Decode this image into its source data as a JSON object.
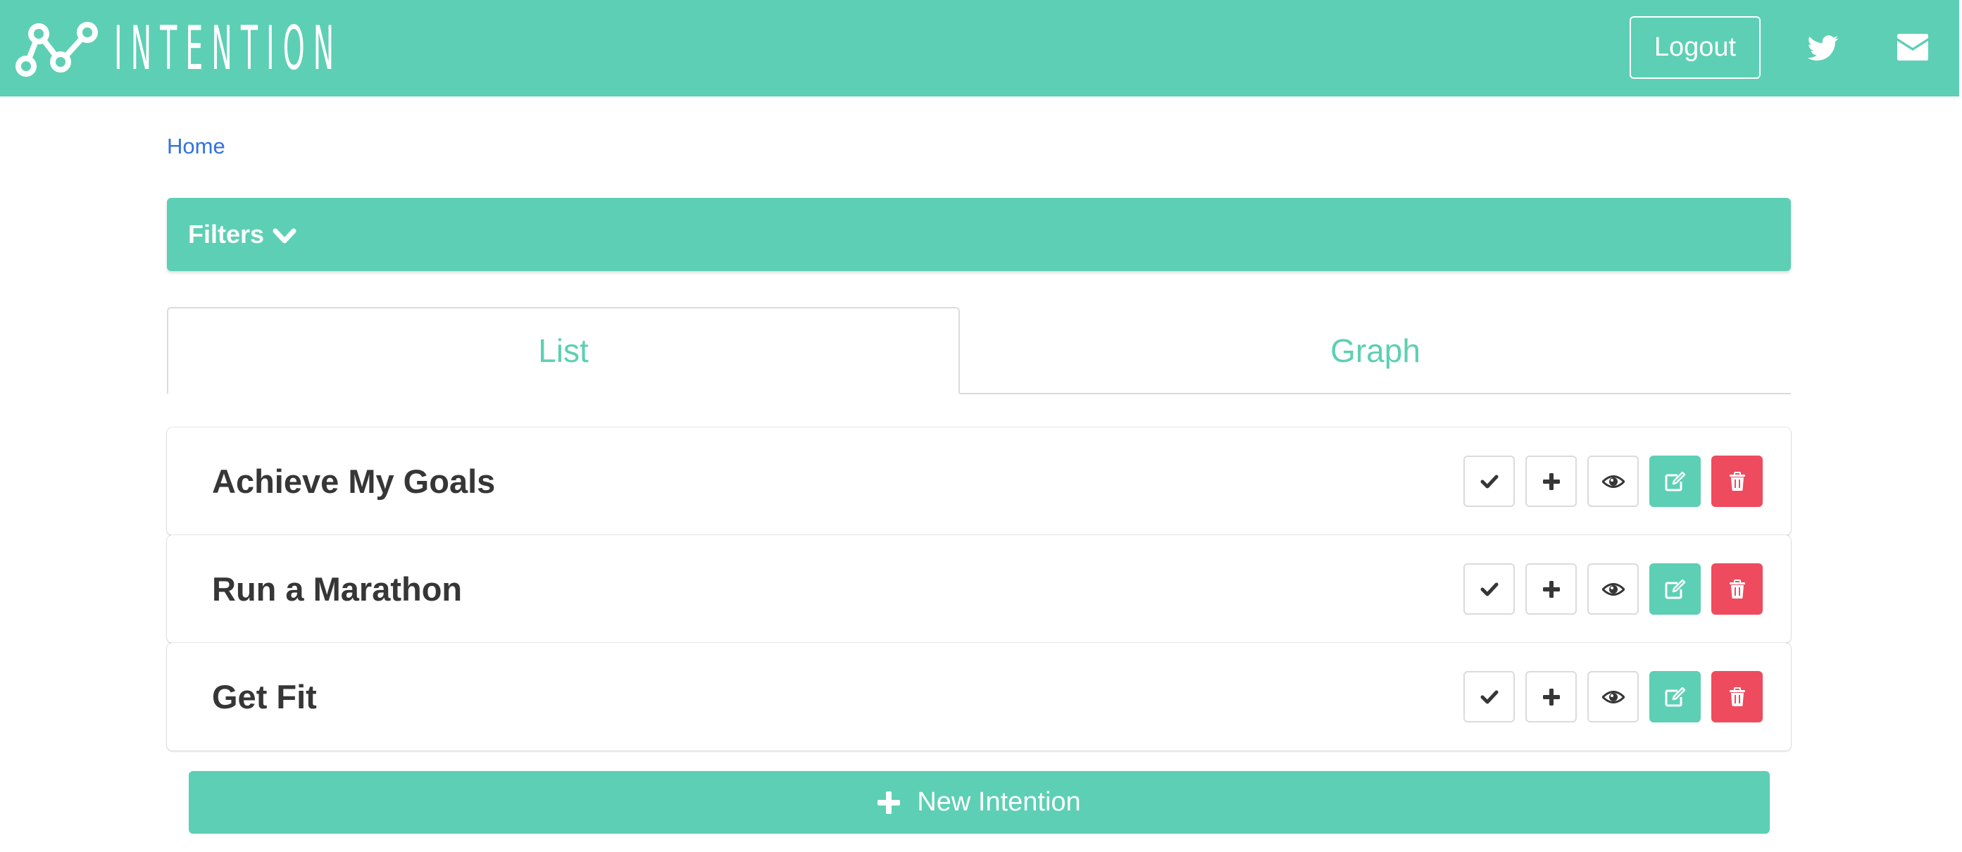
{
  "brand": {
    "icon": "node-graph-logo-icon",
    "name": "INTENTION"
  },
  "navbar": {
    "logout_label": "Logout",
    "icons": [
      "twitter-icon",
      "envelope-icon"
    ]
  },
  "breadcrumb": {
    "home_label": "Home"
  },
  "filters": {
    "label": "Filters",
    "icon": "chevron-down-icon"
  },
  "tabs": [
    {
      "label": "List",
      "active": true
    },
    {
      "label": "Graph",
      "active": false
    }
  ],
  "intentions": [
    {
      "title": "Achieve My Goals"
    },
    {
      "title": "Run a Marathon"
    },
    {
      "title": "Get Fit"
    }
  ],
  "row_actions": [
    "check-icon",
    "plus-icon",
    "eye-icon",
    "edit-icon",
    "trash-icon"
  ],
  "new_button": {
    "label": "New Intention",
    "icon": "plus-icon"
  },
  "colors": {
    "primary": "#5dcfb4",
    "danger": "#ee4b5f",
    "link": "#3273dc",
    "text": "#363636",
    "border": "#dbdbdb"
  }
}
